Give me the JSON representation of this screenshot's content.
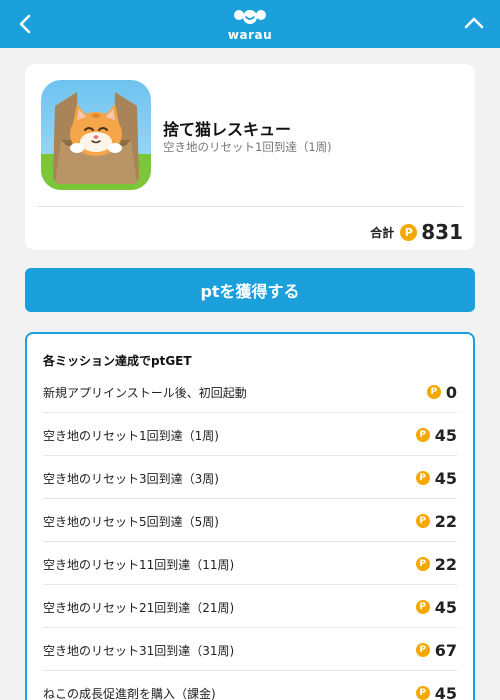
{
  "header": {
    "logo_text": "warau",
    "colors": {
      "brand": "#1ba0dc",
      "coin": "#f5a800"
    }
  },
  "app": {
    "title": "捨て猫レスキュー",
    "subtitle": "空き地のリセット1回到達（1周)",
    "total_label": "合計",
    "coin_symbol": "P",
    "total_value": "831"
  },
  "cta": {
    "label": "ptを獲得する"
  },
  "missions": {
    "heading": "各ミッション達成でptGET",
    "items": [
      {
        "name": "新規アプリインストール後、初回起動",
        "points": "0"
      },
      {
        "name": "空き地のリセット1回到達（1周)",
        "points": "45"
      },
      {
        "name": "空き地のリセット3回到達（3周)",
        "points": "45"
      },
      {
        "name": "空き地のリセット5回到達（5周)",
        "points": "22"
      },
      {
        "name": "空き地のリセット11回到達（11周)",
        "points": "22"
      },
      {
        "name": "空き地のリセット21回到達（21周)",
        "points": "45"
      },
      {
        "name": "空き地のリセット31回到達（31周)",
        "points": "67"
      },
      {
        "name": "ねこの成長促進剤を購入（課金)",
        "points": "45"
      }
    ]
  }
}
